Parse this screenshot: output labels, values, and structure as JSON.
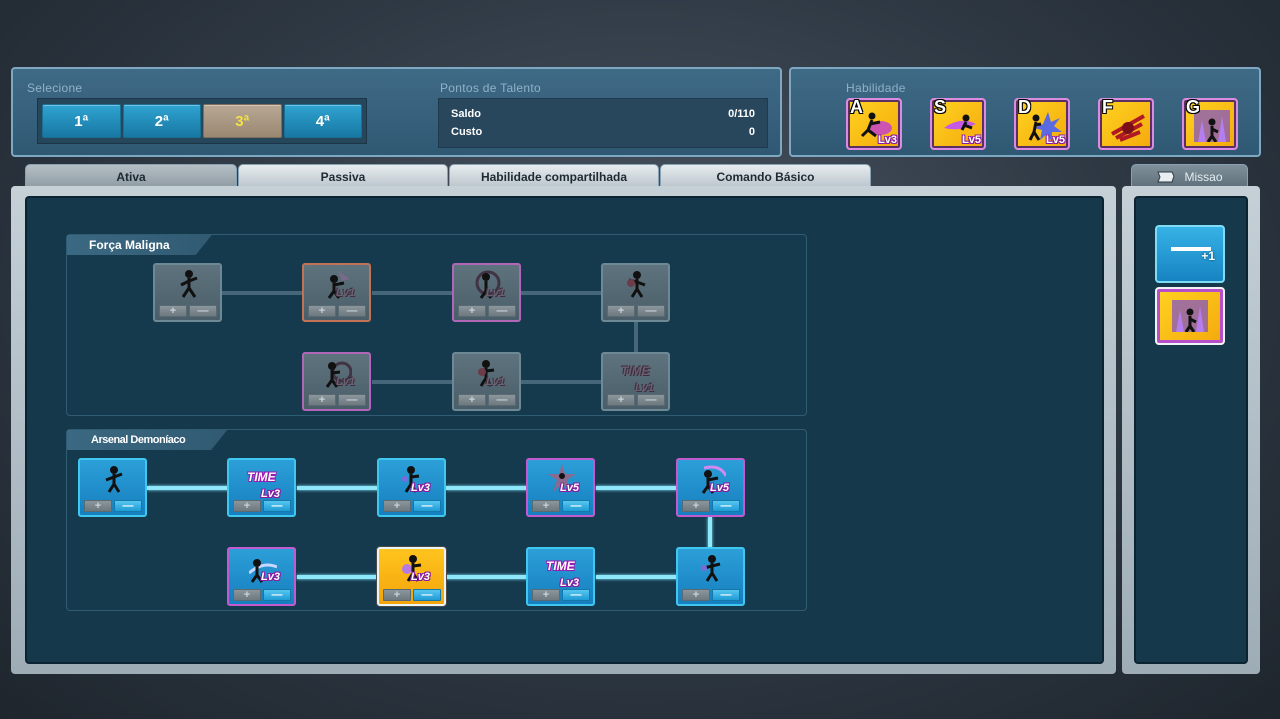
{
  "selecione": {
    "label": "Selecione",
    "options": [
      "1ª",
      "2ª",
      "3ª",
      "4ª"
    ],
    "active_index": 2
  },
  "pontos": {
    "label": "Pontos de Talento",
    "saldo_label": "Saldo",
    "saldo_value": "0/110",
    "custo_label": "Custo",
    "custo_value": "0"
  },
  "habilidade": {
    "label": "Habilidade",
    "slots": [
      {
        "key": "A",
        "level": "Lv3"
      },
      {
        "key": "S",
        "level": "Lv5"
      },
      {
        "key": "D",
        "level": "Lv5"
      },
      {
        "key": "F",
        "level": ""
      },
      {
        "key": "G",
        "level": ""
      }
    ]
  },
  "tabs": [
    "Ativa",
    "Passiva",
    "Habilidade compartilhada",
    "Comando Básico"
  ],
  "active_tab": 0,
  "side": {
    "tab_label": "Missao",
    "item_badge": "+1"
  },
  "trees": {
    "forca": {
      "title": "Força Maligna",
      "nodes": [
        {
          "level": "",
          "time": ""
        },
        {
          "level": "Lv1",
          "time": ""
        },
        {
          "level": "Lv1",
          "time": ""
        },
        {
          "level": "",
          "time": ""
        },
        {
          "level": "Lv1",
          "time": ""
        },
        {
          "level": "Lv1",
          "time": ""
        },
        {
          "level": "Lv1",
          "time": "TIME"
        }
      ]
    },
    "arsenal": {
      "title": "Arsenal Demoníaco",
      "nodes": [
        {
          "level": "",
          "time": ""
        },
        {
          "level": "Lv3",
          "time": "TIME"
        },
        {
          "level": "Lv3",
          "time": ""
        },
        {
          "level": "Lv5",
          "time": ""
        },
        {
          "level": "Lv5",
          "time": ""
        },
        {
          "level": "Lv3",
          "time": ""
        },
        {
          "level": "Lv3",
          "time": ""
        },
        {
          "level": "Lv3",
          "time": "TIME"
        },
        {
          "level": "",
          "time": ""
        }
      ]
    }
  },
  "controls": {
    "plus": "+",
    "minus": "—"
  },
  "colors": {
    "panel": "#2f5873",
    "tree_bg": "#153a4e",
    "node_blue": "#1f8fcb",
    "node_gold": "#f7b514",
    "connector_active": "#8ee8fb",
    "selected_option": "#f2e14a"
  }
}
